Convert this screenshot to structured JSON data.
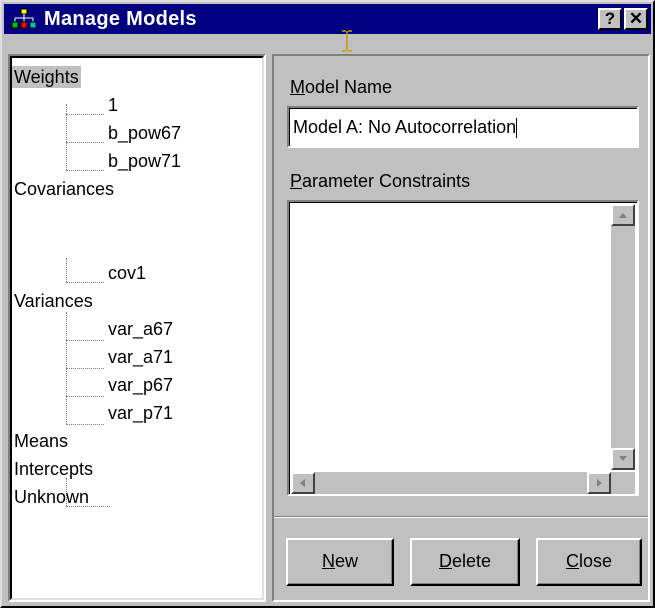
{
  "window": {
    "title": "Manage Models",
    "help_button": "?",
    "close_button": "✕"
  },
  "tree": [
    {
      "label": "Weights",
      "level": 0,
      "selected": true
    },
    {
      "label": "1",
      "level": 1
    },
    {
      "label": "b_pow67",
      "level": 1
    },
    {
      "label": "b_pow71",
      "level": 1
    },
    {
      "label": "Covariances",
      "level": 0
    },
    {
      "label": "cov1",
      "level": 1
    },
    {
      "label": "Variances",
      "level": 0
    },
    {
      "label": "var_a67",
      "level": 1
    },
    {
      "label": "var_a71",
      "level": 1
    },
    {
      "label": "var_p67",
      "level": 1
    },
    {
      "label": "var_p71",
      "level": 1
    },
    {
      "label": "Means",
      "level": 0
    },
    {
      "label": "Intercepts",
      "level": 0
    },
    {
      "label": "Unknown",
      "level": 0
    },
    {
      "label": "",
      "level": 1
    }
  ],
  "model_name": {
    "label_first": "M",
    "label_rest": "odel Name",
    "value": "Model A: No Autocorrelation"
  },
  "parameter_constraints": {
    "label_first": "P",
    "label_rest": "arameter Constraints",
    "value": ""
  },
  "buttons": {
    "new": {
      "first": "N",
      "rest": "ew"
    },
    "delete": {
      "first": "D",
      "rest": "elete"
    },
    "close": {
      "first": "C",
      "rest": "lose"
    }
  }
}
